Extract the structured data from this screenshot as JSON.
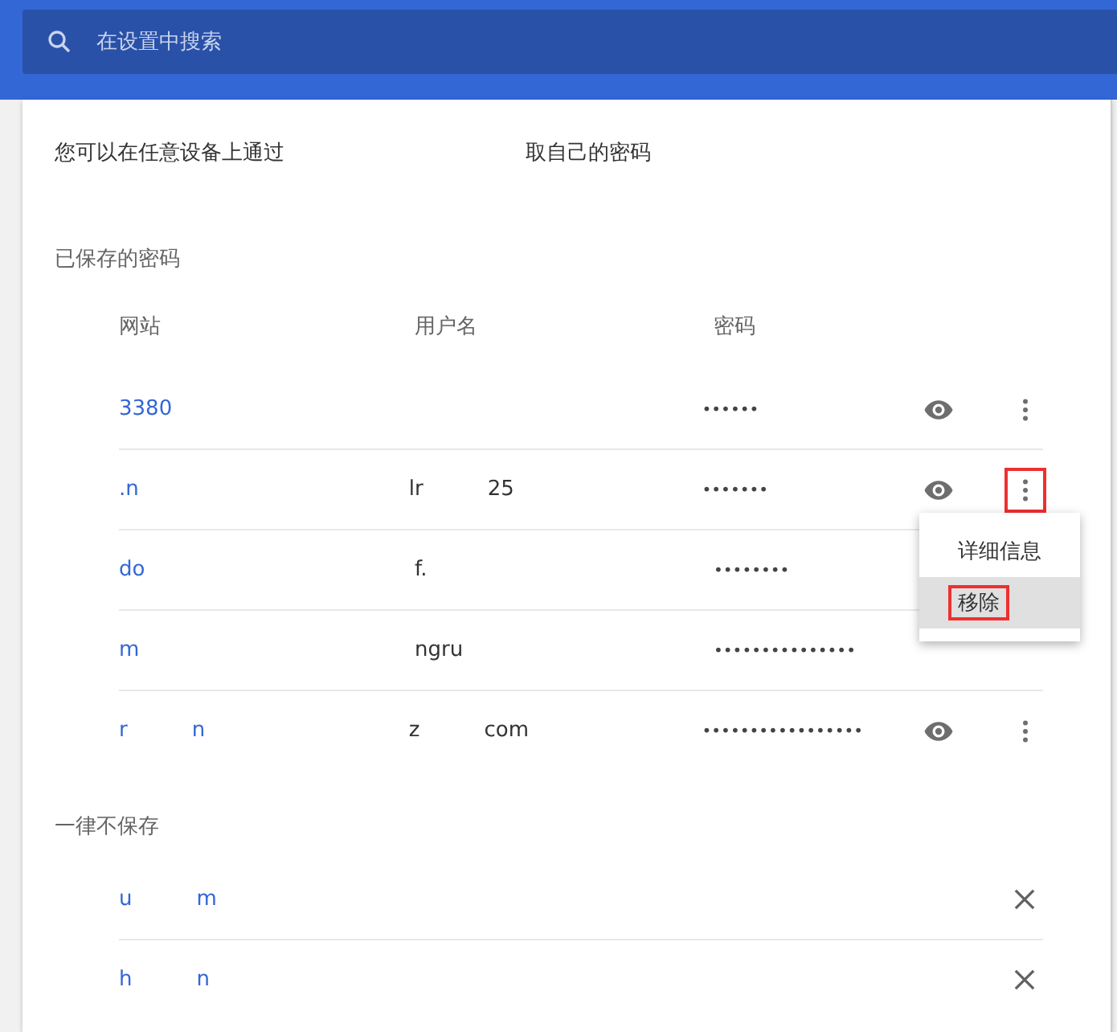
{
  "search": {
    "placeholder": "在设置中搜索"
  },
  "intro": [
    "您可以在任意设备上通过",
    "取自己的密码"
  ],
  "saved": {
    "title": "已保存的密码",
    "columns": [
      "网站",
      "用户名",
      "密码"
    ],
    "rows": [
      {
        "site": [
          "3380"
        ],
        "user": [],
        "password": "••••••",
        "actions_visible": true,
        "menu_highlighted": false
      },
      {
        "site": [
          ".n"
        ],
        "user": [
          "lr",
          "25"
        ],
        "password": "•••••••",
        "actions_visible": true,
        "menu_highlighted": true
      },
      {
        "site": [
          "do"
        ],
        "user": [
          "f."
        ],
        "password": "••••••••",
        "actions_visible": false
      },
      {
        "site": [
          "m"
        ],
        "user": [
          "ngru"
        ],
        "password": "•••••••••••••••",
        "actions_visible": false
      },
      {
        "site": [
          "r",
          "n"
        ],
        "user": [
          "z",
          "com"
        ],
        "password": "•••••••••••••••••",
        "actions_visible": true,
        "menu_highlighted": false
      }
    ]
  },
  "menu": {
    "items": [
      {
        "label": "详细信息",
        "selected": false,
        "highlighted": false
      },
      {
        "label": "移除",
        "selected": true,
        "highlighted": true
      }
    ]
  },
  "never": {
    "title": "一律不保存",
    "rows": [
      {
        "site": [
          "u",
          "m"
        ]
      },
      {
        "site": [
          "h",
          "n"
        ]
      }
    ]
  }
}
